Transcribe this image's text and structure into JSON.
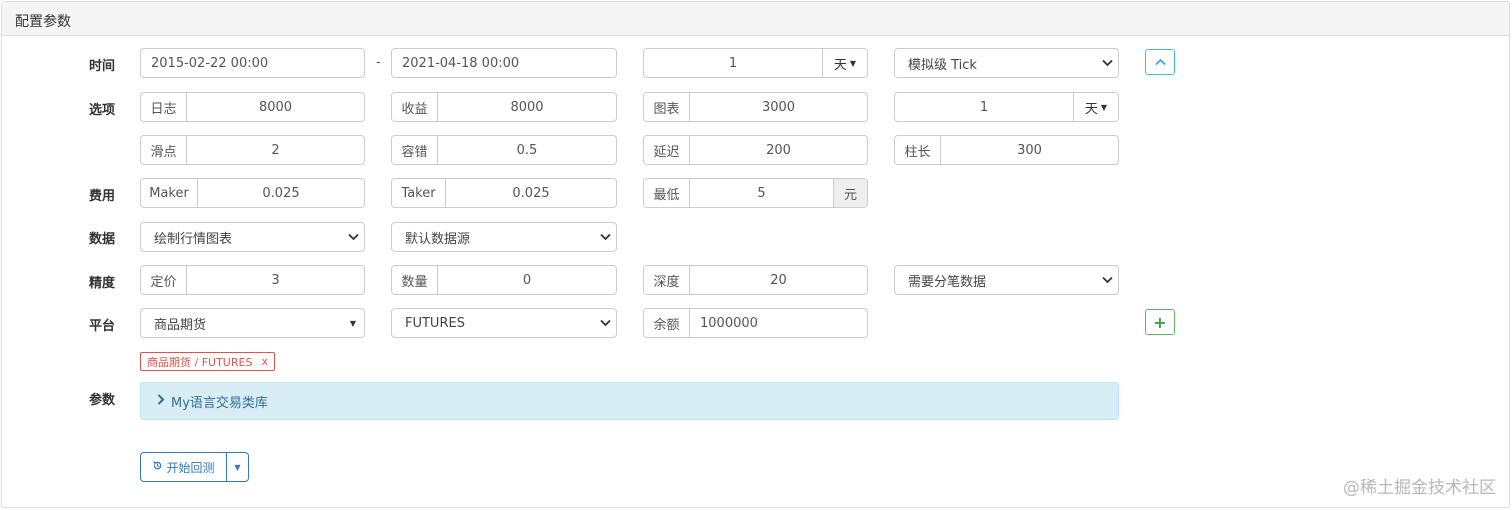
{
  "panel": {
    "title": "配置参数"
  },
  "labels": {
    "time": "时间",
    "options": "选项",
    "fees": "费用",
    "data": "数据",
    "precision": "精度",
    "platform": "平台",
    "params": "参数"
  },
  "time": {
    "start": "2015-02-22 00:00",
    "separator": "-",
    "end": "2021-04-18 00:00",
    "period_value": "1",
    "period_unit": "天",
    "tick_mode": "模拟级 Tick"
  },
  "options": {
    "log_label": "日志",
    "log_value": "8000",
    "profit_label": "收益",
    "profit_value": "8000",
    "chart_label": "图表",
    "chart_value": "3000",
    "kline_value": "1",
    "kline_unit": "天",
    "slippage_label": "滑点",
    "slippage_value": "2",
    "tolerance_label": "容错",
    "tolerance_value": "0.5",
    "delay_label": "延迟",
    "delay_value": "200",
    "bar_label": "柱长",
    "bar_value": "300"
  },
  "fees": {
    "maker_label": "Maker",
    "maker_value": "0.025",
    "taker_label": "Taker",
    "taker_value": "0.025",
    "min_label": "最低",
    "min_value": "5",
    "min_unit": "元"
  },
  "data": {
    "chart_mode": "绘制行情图表",
    "source": "默认数据源"
  },
  "precision": {
    "price_label": "定价",
    "price_value": "3",
    "qty_label": "数量",
    "qty_value": "0",
    "depth_label": "深度",
    "depth_value": "20",
    "tick_data": "需要分笔数据"
  },
  "platform": {
    "exchange": "商品期货",
    "contract": "FUTURES",
    "balance_label": "余额",
    "balance_value": "1000000",
    "tag_text": "商品期货 / FUTURES",
    "tag_close": "x"
  },
  "params": {
    "library": "My语言交易类库"
  },
  "actions": {
    "run_label": "开始回测"
  },
  "watermark": "@稀土掘金技术社区",
  "colors": {
    "accent": "#337ab7",
    "info": "#31a5c9",
    "success": "#5cb85c",
    "danger": "#d9534f"
  }
}
